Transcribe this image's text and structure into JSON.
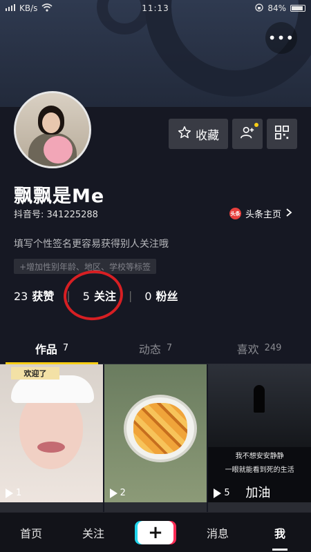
{
  "status_bar": {
    "signal_text": "KB/s",
    "time": "11:13",
    "battery": "84%",
    "battery_level": 0.84
  },
  "header": {
    "more_icon": "more-dots-icon"
  },
  "profile": {
    "nickname": "飘飘是Me",
    "douyin_id": "抖音号: 341225288",
    "toutiao_logo": "头条",
    "toutiao_link": "头条主页",
    "signature": "填写个性签名更容易获得别人关注哦",
    "tag_hint": "+增加性别年龄、地区、学校等标签",
    "favorite_button": "收藏",
    "stats": [
      {
        "value": "23",
        "label": "获赞"
      },
      {
        "value": "5",
        "label": "关注"
      },
      {
        "value": "0",
        "label": "粉丝"
      }
    ]
  },
  "tabs": [
    {
      "label": "作品",
      "count": "7"
    },
    {
      "label": "动态",
      "count": "7"
    },
    {
      "label": "喜欢",
      "count": "249"
    }
  ],
  "videos": [
    {
      "plays": "1",
      "sticker": "欢迎了"
    },
    {
      "plays": "2"
    },
    {
      "plays": "5",
      "line1": "我不想安安静静",
      "line2": "一眼就能看到死的生活",
      "caption": "加油"
    }
  ],
  "bottom_nav": {
    "home": "首页",
    "following": "关注",
    "plus": "+",
    "messages": "消息",
    "me": "我"
  },
  "colors": {
    "accent_yellow": "#face15",
    "annotation_red": "#d71f23",
    "background": "#161823"
  }
}
